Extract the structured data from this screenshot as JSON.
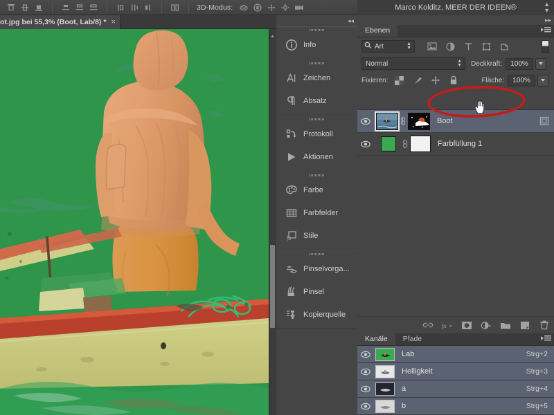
{
  "app": {
    "title": "Marco Kolditz, MEER DER IDEEN®",
    "mode_3d_label": "3D-Modus:"
  },
  "document_tab": {
    "title": "ot.jpg bei 55,3%  (Boot, Lab/8) *",
    "close": "×"
  },
  "options_bar": {
    "align_icons": [
      "align-top-edges-icon",
      "align-vertical-centers-icon",
      "align-bottom-edges-icon"
    ],
    "distribute_icons": [
      "distribute-top-edges-icon",
      "distribute-vertical-centers-icon",
      "distribute-bottom-edges-icon"
    ],
    "distribute_h_icons": [
      "distribute-left-edges-icon",
      "distribute-horizontal-centers-icon",
      "distribute-right-edges-icon"
    ],
    "auto_align_icon": "auto-align-layers-icon",
    "mode_3d_icons": [
      "3d-orbit-icon",
      "3d-roll-icon",
      "3d-pan-icon",
      "3d-slide-icon",
      "3d-camera-icon"
    ]
  },
  "icon_dock": {
    "collapse_label": "◂◂",
    "groups": [
      {
        "items": [
          {
            "label": "Info",
            "icon": "info-icon"
          }
        ]
      },
      {
        "items": [
          {
            "label": "Zeichen",
            "icon": "character-icon"
          },
          {
            "label": "Absatz",
            "icon": "paragraph-icon"
          }
        ]
      },
      {
        "items": [
          {
            "label": "Protokoll",
            "icon": "history-icon"
          },
          {
            "label": "Aktionen",
            "icon": "actions-play-icon"
          }
        ]
      },
      {
        "items": [
          {
            "label": "Farbe",
            "icon": "color-palette-icon"
          },
          {
            "label": "Farbfelder",
            "icon": "swatches-grid-icon"
          },
          {
            "label": "Stile",
            "icon": "styles-fx-icon"
          }
        ]
      },
      {
        "items": [
          {
            "label": "Pinselvorga...",
            "icon": "brush-presets-icon"
          },
          {
            "label": "Pinsel",
            "icon": "brush-icon"
          },
          {
            "label": "Kopierquelle",
            "icon": "clone-source-icon"
          }
        ]
      }
    ]
  },
  "right_dock": {
    "collapse_label": "▸▸"
  },
  "layers_panel": {
    "tabs": [
      {
        "label": "Ebenen",
        "active": true
      }
    ],
    "menu_icon": "panel-menu-icon",
    "filter": {
      "search_icon": "search-icon",
      "kind_label": "Art",
      "type_icons": [
        "filter-pixel-icon",
        "filter-adjustment-icon",
        "filter-type-icon",
        "filter-shape-icon",
        "filter-smartobject-icon"
      ],
      "toggle_icon": "filter-enable-toggle"
    },
    "blend_mode": "Normal",
    "opacity_label": "Deckkraft:",
    "opacity_value": "100%",
    "lock_label": "Fixieren:",
    "lock_icons": [
      "lock-transparent-pixels-icon",
      "lock-image-pixels-icon",
      "lock-position-icon",
      "lock-all-icon"
    ],
    "fill_label": "Fläche:",
    "fill_value": "100%",
    "layers": [
      {
        "name": "Boot",
        "visible": true,
        "selected": true,
        "thumb": "photo-thumbnail",
        "linked_icon": "link-icon",
        "mask": "layer-mask-thumbnail",
        "extra_icon": "smart-object-badge-icon"
      },
      {
        "name": "Farbfüllung 1",
        "visible": true,
        "selected": false,
        "thumb": "solid-color-green-thumbnail",
        "linked_icon": "link-icon",
        "mask": "white-mask-thumbnail",
        "extra_icon": ""
      }
    ],
    "bottom_buttons": [
      {
        "icon": "link-layers-icon"
      },
      {
        "icon": "layer-fx-icon"
      },
      {
        "icon": "add-layer-mask-icon"
      },
      {
        "icon": "new-adjustment-layer-icon"
      },
      {
        "icon": "new-group-icon"
      },
      {
        "icon": "new-layer-icon"
      },
      {
        "icon": "delete-layer-icon"
      }
    ]
  },
  "channels_panel": {
    "tabs": [
      {
        "label": "Kanäle",
        "active": true
      },
      {
        "label": "Pfade",
        "active": false
      }
    ],
    "menu_icon": "panel-menu-icon",
    "channels": [
      {
        "name": "Lab",
        "shortcut": "Strg+2",
        "visible": true,
        "thumb": "lab-composite-thumbnail"
      },
      {
        "name": "Helligkeit",
        "shortcut": "Strg+3",
        "visible": true,
        "thumb": "lightness-thumbnail"
      },
      {
        "name": "a",
        "shortcut": "Strg+4",
        "visible": true,
        "thumb": "a-channel-thumbnail"
      },
      {
        "name": "b",
        "shortcut": "Strg+5",
        "visible": true,
        "thumb": "b-channel-thumbnail"
      }
    ]
  },
  "annotation": {
    "ellipse_color": "#c21d1d",
    "cursor": "hand-pointer-cursor"
  },
  "canvas": {
    "description": "photo-of-fisherman-in-orange-raincoat-on-boat-green-background",
    "green_background": "#2e8b45",
    "scrollbar": "vertical-scrollbar"
  }
}
